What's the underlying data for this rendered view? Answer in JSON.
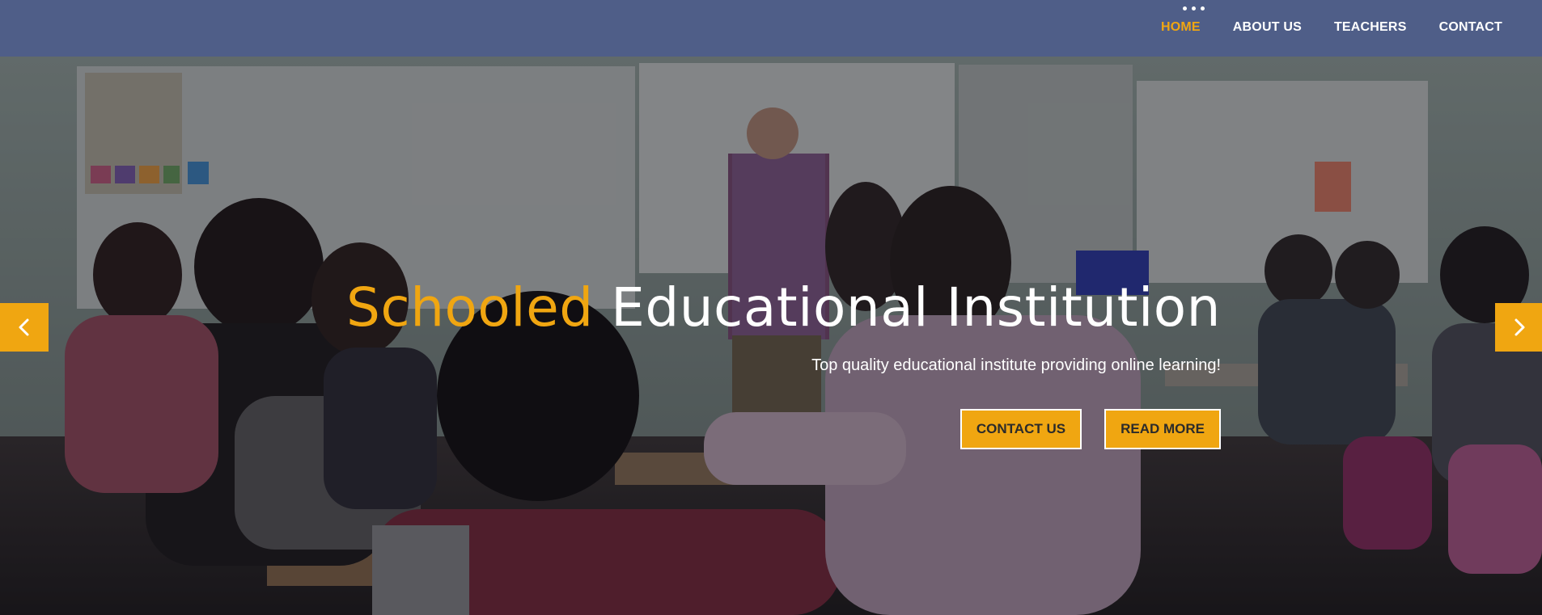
{
  "nav": {
    "items": [
      {
        "label": "HOME",
        "active": true
      },
      {
        "label": "ABOUT US",
        "active": false
      },
      {
        "label": "TEACHERS",
        "active": false
      },
      {
        "label": "CONTACT",
        "active": false
      }
    ]
  },
  "hero": {
    "title_accent": "Schooled",
    "title_rest": "Educational Institution",
    "subtitle": "Top quality educational institute providing online learning!",
    "buttons": {
      "contact": "CONTACT US",
      "read_more": "READ MORE"
    }
  },
  "carousel": {
    "prev_icon": "chevron-left-icon",
    "next_icon": "chevron-right-icon"
  },
  "colors": {
    "header_bg": "#4f5e88",
    "accent": "#f0a611",
    "text": "#ffffff"
  }
}
